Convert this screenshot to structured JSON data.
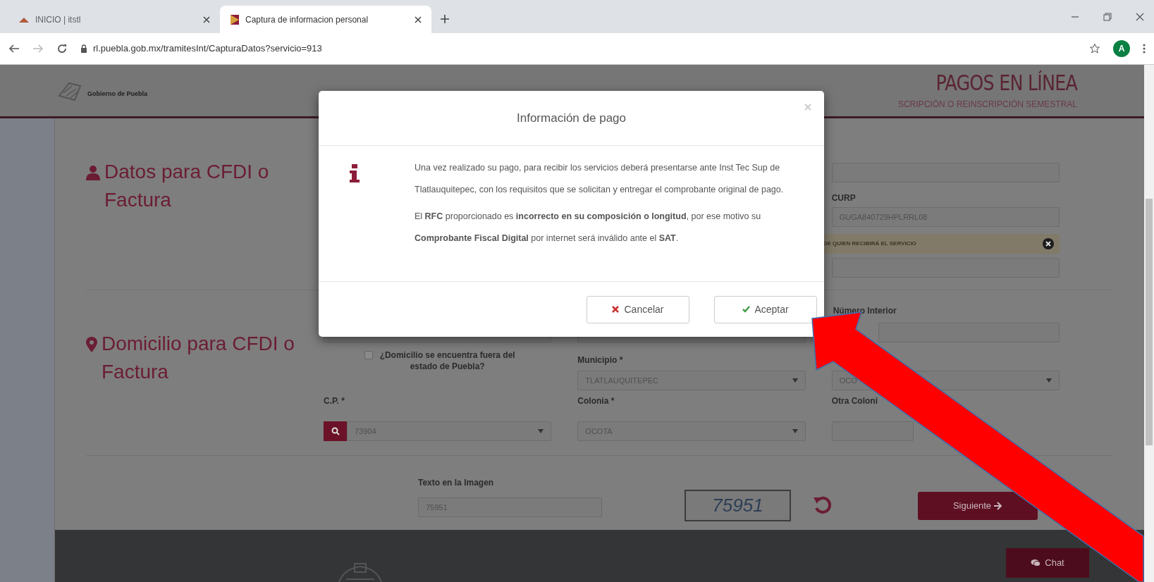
{
  "browser": {
    "tabs": [
      {
        "title": "INICIO | itstl",
        "selected": false
      },
      {
        "title": "Captura de informacion personal",
        "selected": true
      }
    ],
    "url": "rl.puebla.gob.mx/tramitesInt/CapturaDatos?servicio=913",
    "profile_initial": "A"
  },
  "header": {
    "logo_text": "Gobierno de Puebla",
    "title": "PAGOS EN LÍNEA",
    "subtitle": "SCRIPCIÓN O REINSCRIPCIÓN SEMESTRAL"
  },
  "datos_section": {
    "heading": "Datos para CFDI o Factura",
    "curp_label": "CURP",
    "curp_value": "GUGA840729HPLRRL08",
    "alert": "DE QUIEN RECIBIRÁ EL SERVICIO"
  },
  "domicilio_section": {
    "heading": "Domicilio para CFDI o Factura",
    "numero_interior_label": "Número Interior",
    "outside_state": {
      "label": "¿Domicilio se encuentra fuera del estado de Puebla?",
      "checked": false
    },
    "cp": {
      "label": "C.P. *",
      "value": "73904"
    },
    "municipio": {
      "label": "Municipio *",
      "value": "TLATLAUQUITEPEC"
    },
    "column_3_value": "OCO",
    "colonia": {
      "label": "Colonia *",
      "value": "OCOTA"
    },
    "otra_colonia_label": "Otra Coloni"
  },
  "captcha": {
    "label": "Texto en la Imagen",
    "value": "75951",
    "image_text": "75951"
  },
  "next_button": "Siguiente",
  "chat_button": "Chat",
  "modal": {
    "title": "Información de pago",
    "paragraphs": [
      "Una vez realizado su pago, para recibir los servicios deberá presentarse ante Inst Tec Sup de Tlatlauquitepec, con los requisitos que se solicitan y entregar el comprobante original de pago.",
      "El **RFC** proporcionado es **incorrecto en su composición o longitud**, por ese motivo su **Comprobante Fiscal Digital** por internet será inválido ante el **SAT**."
    ],
    "buttons": [
      {
        "label": "Cancelar",
        "kind": "cancel"
      },
      {
        "label": "Aceptar",
        "kind": "accept"
      }
    ]
  }
}
